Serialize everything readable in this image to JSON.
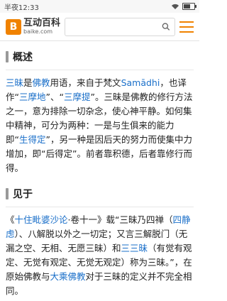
{
  "status_bar": {
    "time": "半夜12:33"
  },
  "header": {
    "logo_mark": "B",
    "logo_cn": "互动百科",
    "logo_en": "baike.com",
    "search_placeholder": ""
  },
  "sections": [
    {
      "title": "概述",
      "parts": [
        {
          "t": "三昧",
          "link": true
        },
        {
          "t": "是"
        },
        {
          "t": "佛教",
          "link": true
        },
        {
          "t": "用语，来自于梵文"
        },
        {
          "t": "Samādhi",
          "link": true
        },
        {
          "t": "，也译作“"
        },
        {
          "t": "三摩地",
          "link": true
        },
        {
          "t": "”、“"
        },
        {
          "t": "三摩提",
          "link": true
        },
        {
          "t": "”。三昧是佛教的修行方法之一，意为排除一切杂念，使心神平静。如何集中精神，可分为两种：一是与生俱来的能力即“"
        },
        {
          "t": "生得定",
          "link": true
        },
        {
          "t": "”，另一种是因后天的努力而使集中力增加，即“后得定”。前者靠积德，后者靠修行而得。"
        }
      ]
    },
    {
      "title": "见于",
      "parts": [
        {
          "t": "《"
        },
        {
          "t": "十住毗婆沙论",
          "link": true
        },
        {
          "t": "·卷十一》载“三昧乃四禅（"
        },
        {
          "t": "四静虑",
          "link": true
        },
        {
          "t": "）、八解脱以外之一切定；又言三解脱门（无漏之空、无相、无愿三昧）和"
        },
        {
          "t": "三三昧",
          "link": true
        },
        {
          "t": "（有觉有观定、无觉有观定、无觉无观定）称为三昧。”，在原始佛教与"
        },
        {
          "t": "大乘佛教",
          "link": true
        },
        {
          "t": "对于三昧的定义并不完全相同。"
        }
      ]
    }
  ]
}
